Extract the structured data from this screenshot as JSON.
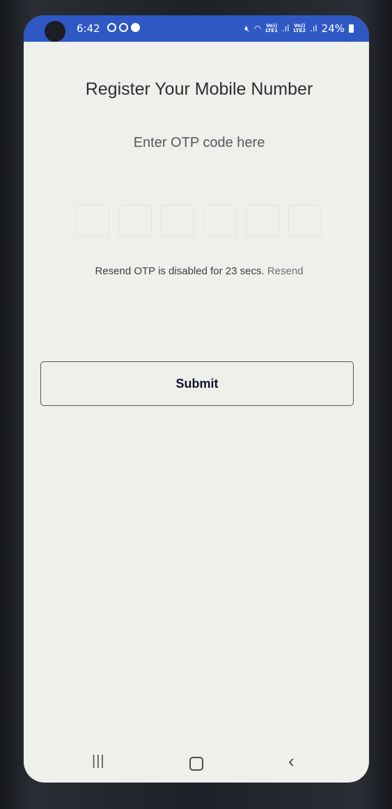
{
  "statusbar": {
    "time": "6:42",
    "lte1_top": "Vo))",
    "lte1_bottom": "LTE1",
    "lte2_top": "Vo))",
    "lte2_bottom": "LTE2",
    "battery": "24%"
  },
  "page": {
    "title": "Register Your Mobile Number",
    "otp_label": "Enter OTP code here",
    "otp_values": [
      "",
      "",
      "",
      "",
      "",
      ""
    ],
    "resend_text": "Resend OTP is disabled for 23 secs.",
    "resend_link": "Resend",
    "submit_label": "Submit"
  },
  "navbar": {
    "recents_icon": "recents-icon",
    "home_icon": "home-icon",
    "back_icon": "back-icon"
  },
  "colors": {
    "statusbar_bg": "#2f58c4",
    "screen_bg": "#eef0ec",
    "submit_text": "#12162a"
  }
}
